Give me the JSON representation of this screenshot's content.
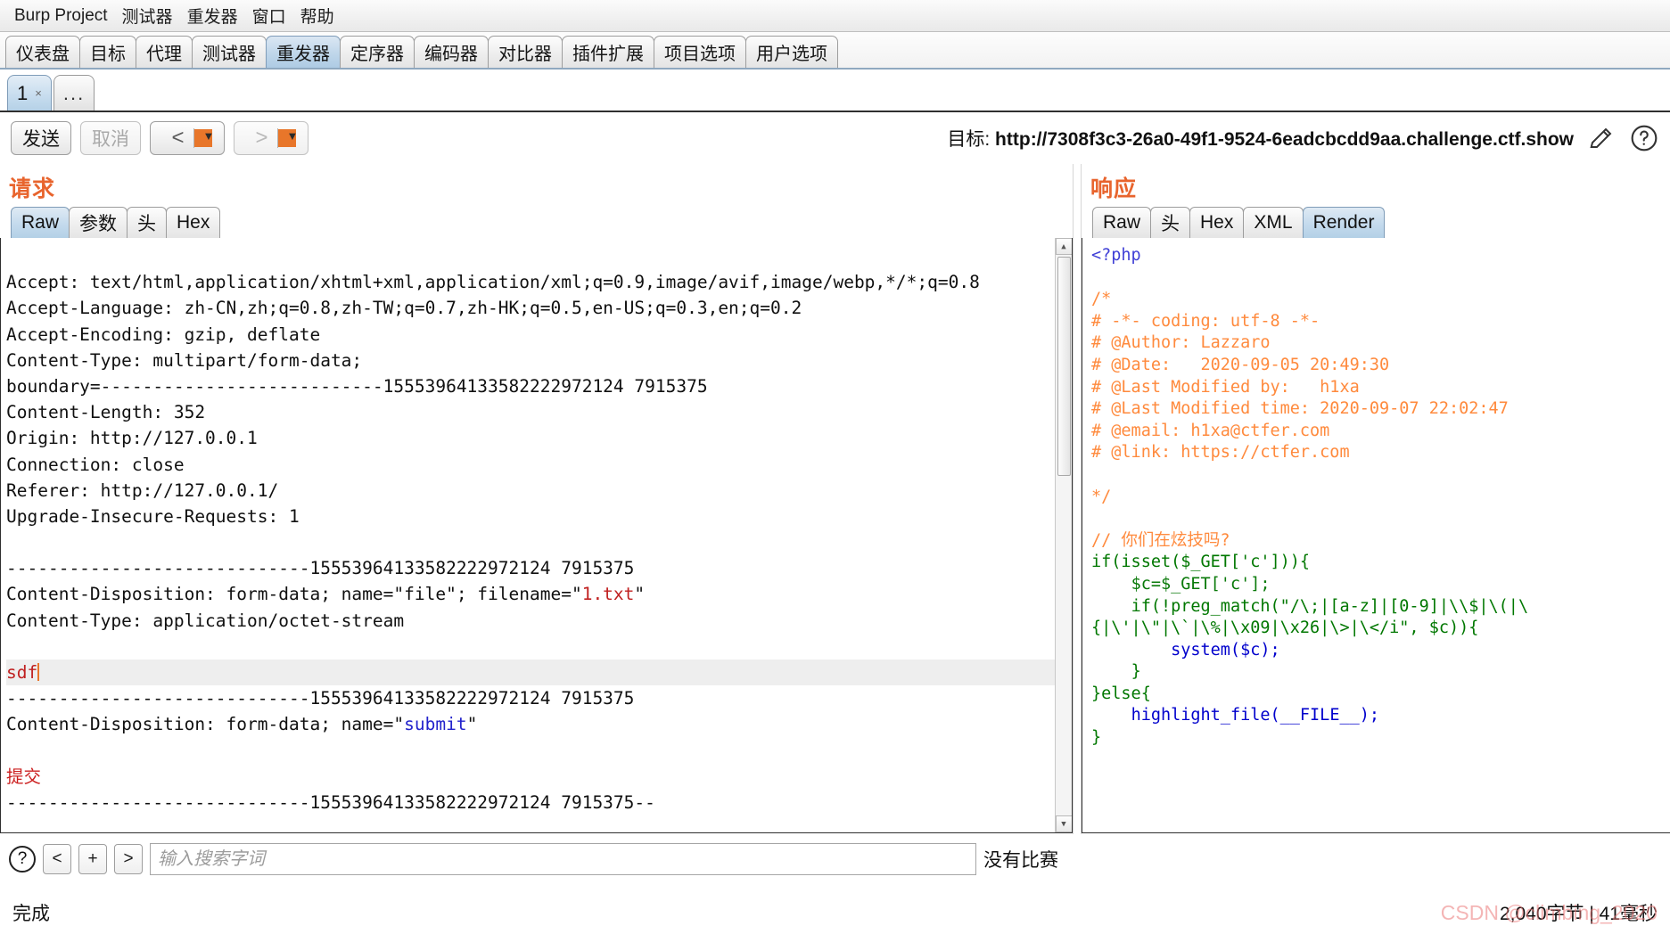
{
  "menubar": {
    "items": [
      {
        "label": "Burp Project"
      },
      {
        "label": "测试器"
      },
      {
        "label": "重发器"
      },
      {
        "label": "窗口"
      },
      {
        "label": "帮助"
      }
    ]
  },
  "main_tabs": {
    "active": "重发器",
    "items": [
      {
        "label": "仪表盘"
      },
      {
        "label": "目标"
      },
      {
        "label": "代理"
      },
      {
        "label": "测试器"
      },
      {
        "label": "重发器"
      },
      {
        "label": "定序器"
      },
      {
        "label": "编码器"
      },
      {
        "label": "对比器"
      },
      {
        "label": "插件扩展"
      },
      {
        "label": "项目选项"
      },
      {
        "label": "用户选项"
      }
    ]
  },
  "repeater_tabs": {
    "items": [
      {
        "label": "1",
        "close": "×",
        "active": true
      },
      {
        "label": "...",
        "active": false
      }
    ]
  },
  "toolbar": {
    "send_label": "发送",
    "cancel_label": "取消",
    "back_glyph": "<",
    "forward_glyph": ">",
    "caret_glyph": "▼",
    "target_prefix": "目标:",
    "target_url": "http://7308f3c3-26a0-49f1-9524-6eadcbcdd9aa.challenge.ctf.show",
    "edit_icon": "pencil-icon",
    "help_icon": "question-icon"
  },
  "request_panel": {
    "title": "请求",
    "tabs": [
      {
        "label": "Raw",
        "active": true
      },
      {
        "label": "参数",
        "active": false
      },
      {
        "label": "头",
        "active": false
      },
      {
        "label": "Hex",
        "active": false
      }
    ],
    "lines": [
      "Accept: text/html,application/xhtml+xml,application/xml;q=0.9,image/avif,image/webp,*/*;q=0.8",
      "Accept-Language: zh-CN,zh;q=0.8,zh-TW;q=0.7,zh-HK;q=0.5,en-US;q=0.3,en;q=0.2",
      "Accept-Encoding: gzip, deflate",
      "Content-Type: multipart/form-data;",
      "boundary=---------------------------15553964133582222972124 7915375",
      "Content-Length: 352",
      "Origin: http://127.0.0.1",
      "Connection: close",
      "Referer: http://127.0.0.1/",
      "Upgrade-Insecure-Requests: 1",
      "",
      "-----------------------------15553964133582222972124 7915375",
      "Content-Disposition: form-data; name=\"file\"; filename=\"1.txt\"",
      "Content-Type: application/octet-stream",
      "",
      "sdf",
      "-----------------------------15553964133582222972124 7915375",
      "Content-Disposition: form-data; name=\"submit\"",
      "",
      "提交",
      "-----------------------------15553964133582222972124 7915375--"
    ],
    "boundary": "15553964133582222972124 7915375",
    "boundary_raw": "15553964133582222972124",
    "filename_value": "1.txt",
    "submit_name": "submit",
    "body_text": "sdf",
    "submit_value": "提交"
  },
  "response_panel": {
    "title": "响应",
    "tabs": [
      {
        "label": "Raw",
        "active": false
      },
      {
        "label": "头",
        "active": false
      },
      {
        "label": "Hex",
        "active": false
      },
      {
        "label": "XML",
        "active": false
      },
      {
        "label": "Render",
        "active": true
      }
    ],
    "code": {
      "php_open": "<?php",
      "comment_block": [
        "/*",
        "# -*- coding: utf-8 -*-",
        "# @Author: Lazzaro",
        "# @Date:   2020-09-05 20:49:30",
        "# @Last Modified by:   h1xa",
        "# @Last Modified time: 2020-09-07 22:02:47",
        "# @email: h1xa@ctfer.com",
        "# @link: https://ctfer.com",
        "",
        "*/"
      ],
      "inline_comment": "// 你们在炫技吗?",
      "line_if_isset": "if(isset($_GET['c'])){",
      "line_assign": "$c=$_GET['c'];",
      "line_preg_1": "if(!preg_match(\"/\\;|[a-z]|[0-9]|\\\\$|\\(|\\",
      "line_preg_2": "{|\\'|\\\"|\\`|\\%|\\x09|\\x26|\\>|\\</i\", $c)){",
      "line_system": "system($c);",
      "line_close_inner": "}",
      "line_else": "}else{",
      "line_highlight": "highlight_file(__FILE__);",
      "line_close_outer": "}"
    }
  },
  "findbar": {
    "help_glyph": "?",
    "prev_glyph": "<",
    "add_glyph": "+",
    "next_glyph": ">",
    "placeholder": "输入搜索字词",
    "value": "",
    "no_match_label": "没有比赛"
  },
  "statusbar": {
    "left": "完成",
    "bytes_time": "2,040字节 | 41毫秒",
    "watermark": "CSDN @climbing_2020"
  }
}
